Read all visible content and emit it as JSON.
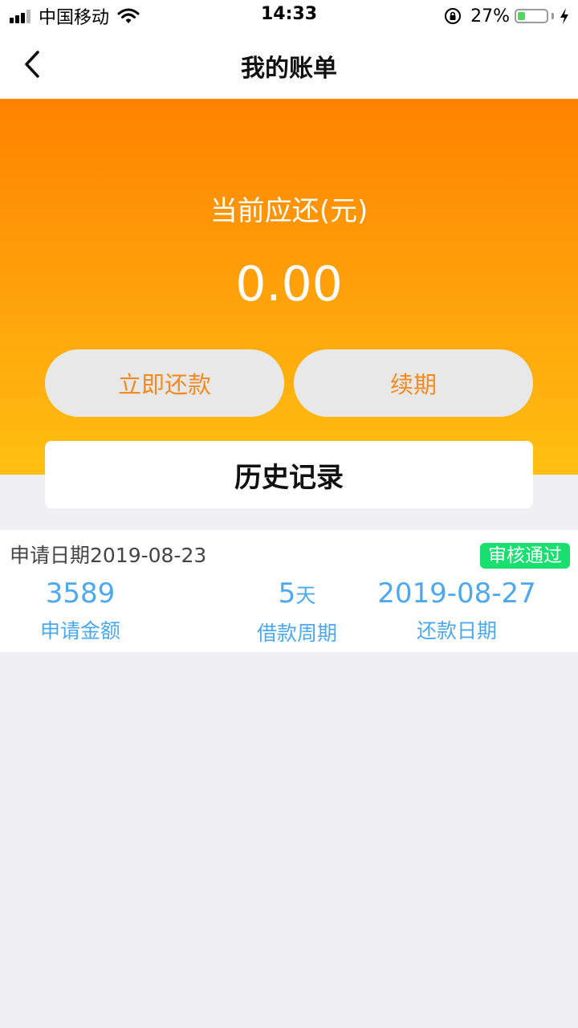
{
  "status_bar": {
    "carrier": "中国移动",
    "time": "14:33",
    "battery_pct": "27%",
    "battery_level": 0.27,
    "icons": [
      "signal-icon",
      "wifi-icon",
      "orientation-lock-icon",
      "battery-icon",
      "charging-bolt-icon"
    ]
  },
  "nav": {
    "title": "我的账单",
    "back_icon": "chevron-left-icon"
  },
  "hero": {
    "label": "当前应还(元)",
    "amount": "0.00",
    "repay_button": "立即还款",
    "renew_button": "续期",
    "gradient_colors": [
      "#ff8200",
      "#ffc012"
    ]
  },
  "history": {
    "title": "历史记录"
  },
  "records": [
    {
      "apply_date": "申请日期2019-08-23",
      "status": "审核通过",
      "amount_value": "3589",
      "amount_label": "申请金额",
      "period_value": "5",
      "period_unit": "天",
      "period_label": "借款周期",
      "due_date_value": "2019-08-27",
      "due_date_label": "还款日期"
    }
  ],
  "colors": {
    "accent_orange": "#f58a1f",
    "metric_blue": "#4ea8ee",
    "status_green": "#18e070",
    "page_background": "#efeff4"
  }
}
